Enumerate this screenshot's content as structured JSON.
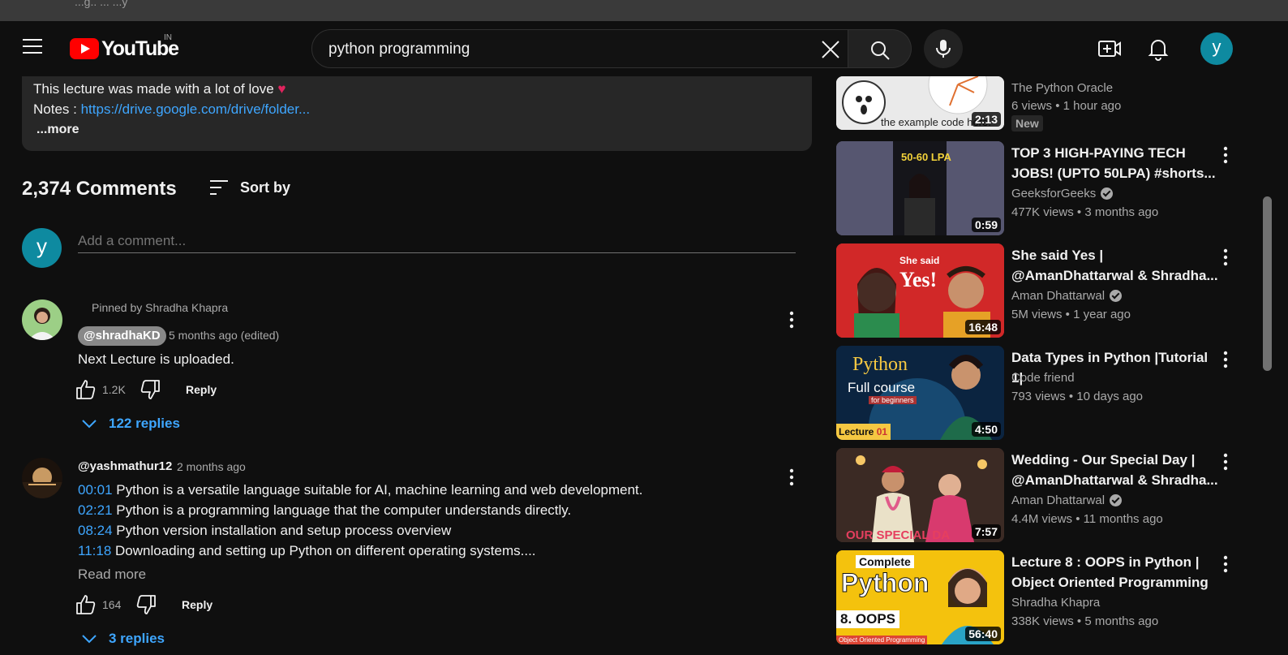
{
  "browser": {
    "tab_ghost_text": "...g.. ... ...y"
  },
  "header": {
    "logo_text": "YouTube",
    "country_code": "IN",
    "search_value": "python programming",
    "avatar_letter": "y"
  },
  "description": {
    "line1": "This lecture was made with a lot of love",
    "heart": "♥",
    "notes_label": "Notes : ",
    "notes_link": "https://drive.google.com/drive/folder...",
    "more_label": "...more"
  },
  "comments": {
    "count_title": "2,374 Comments",
    "sort_label": "Sort by",
    "my_avatar_letter": "y",
    "add_placeholder": "Add a comment...",
    "items": [
      {
        "pinned_label": "Pinned by Shradha Khapra",
        "author": "@shradhaKD",
        "time": "5 months ago (edited)",
        "text": "Next Lecture is uploaded.",
        "likes": "1.2K",
        "reply_label": "Reply",
        "replies_label": "122 replies"
      },
      {
        "author": "@yashmathur12",
        "time": "2 months ago",
        "lines": [
          {
            "ts": "00:01",
            "text": " Python is a versatile language suitable for AI, machine learning and web development."
          },
          {
            "ts": "02:21",
            "text": " Python is a programming language that the computer understands directly."
          },
          {
            "ts": "08:24",
            "text": " Python version installation and setup process overview"
          },
          {
            "ts": "11:18",
            "text": " Downloading and setting up Python on different operating systems...."
          }
        ],
        "read_more": "Read more",
        "likes": "164",
        "reply_label": "Reply",
        "replies_label": "3 replies"
      }
    ]
  },
  "recommendations": [
    {
      "title": "",
      "channel": "The Python Oracle",
      "verified": false,
      "views": "6 views",
      "age": "1 hour ago",
      "duration": "2:13",
      "badge": "New",
      "thumb_text": "the example code here."
    },
    {
      "title": "TOP 3 HIGH-PAYING TECH JOBS! (UPTO 50LPA) #shorts...",
      "channel": "GeeksforGeeks",
      "verified": true,
      "views": "477K views",
      "age": "3 months ago",
      "duration": "0:59",
      "thumb_text": "50-60 LPA"
    },
    {
      "title": "She said Yes | @AmanDhattarwal & Shradha...",
      "channel": "Aman Dhattarwal",
      "verified": true,
      "views": "5M views",
      "age": "1 year ago",
      "duration": "16:48",
      "thumb_text_small": "She said",
      "thumb_text": "Yes!"
    },
    {
      "title": "Data Types in Python |Tutorial 1|",
      "channel": "Code friend",
      "verified": false,
      "views": "793 views",
      "age": "10 days ago",
      "duration": "4:50",
      "thumb_text": "Python",
      "thumb_text2": "Full course",
      "thumb_text3": "for beginners",
      "thumb_text4": "Lecture",
      "thumb_text5": "01"
    },
    {
      "title": "Wedding - Our Special Day | @AmanDhattarwal & Shradha...",
      "channel": "Aman Dhattarwal",
      "verified": true,
      "views": "4.4M views",
      "age": "11 months ago",
      "duration": "7:57",
      "thumb_text": "OUR SPECIAL DA"
    },
    {
      "title": "Lecture 8 : OOPS in Python | Object Oriented Programming ...",
      "channel": "Shradha Khapra",
      "verified": false,
      "views": "338K views",
      "age": "5 months ago",
      "duration": "56:40",
      "thumb_text_small": "Complete",
      "thumb_text": "Python",
      "thumb_text2": "8. OOPS",
      "thumb_text3": "Object Oriented Programming"
    }
  ],
  "colors": {
    "accent_link": "#3ea6ff",
    "brand_red": "#ff0000",
    "background": "#0f0f0f",
    "avatar": "#0e8aa0"
  }
}
